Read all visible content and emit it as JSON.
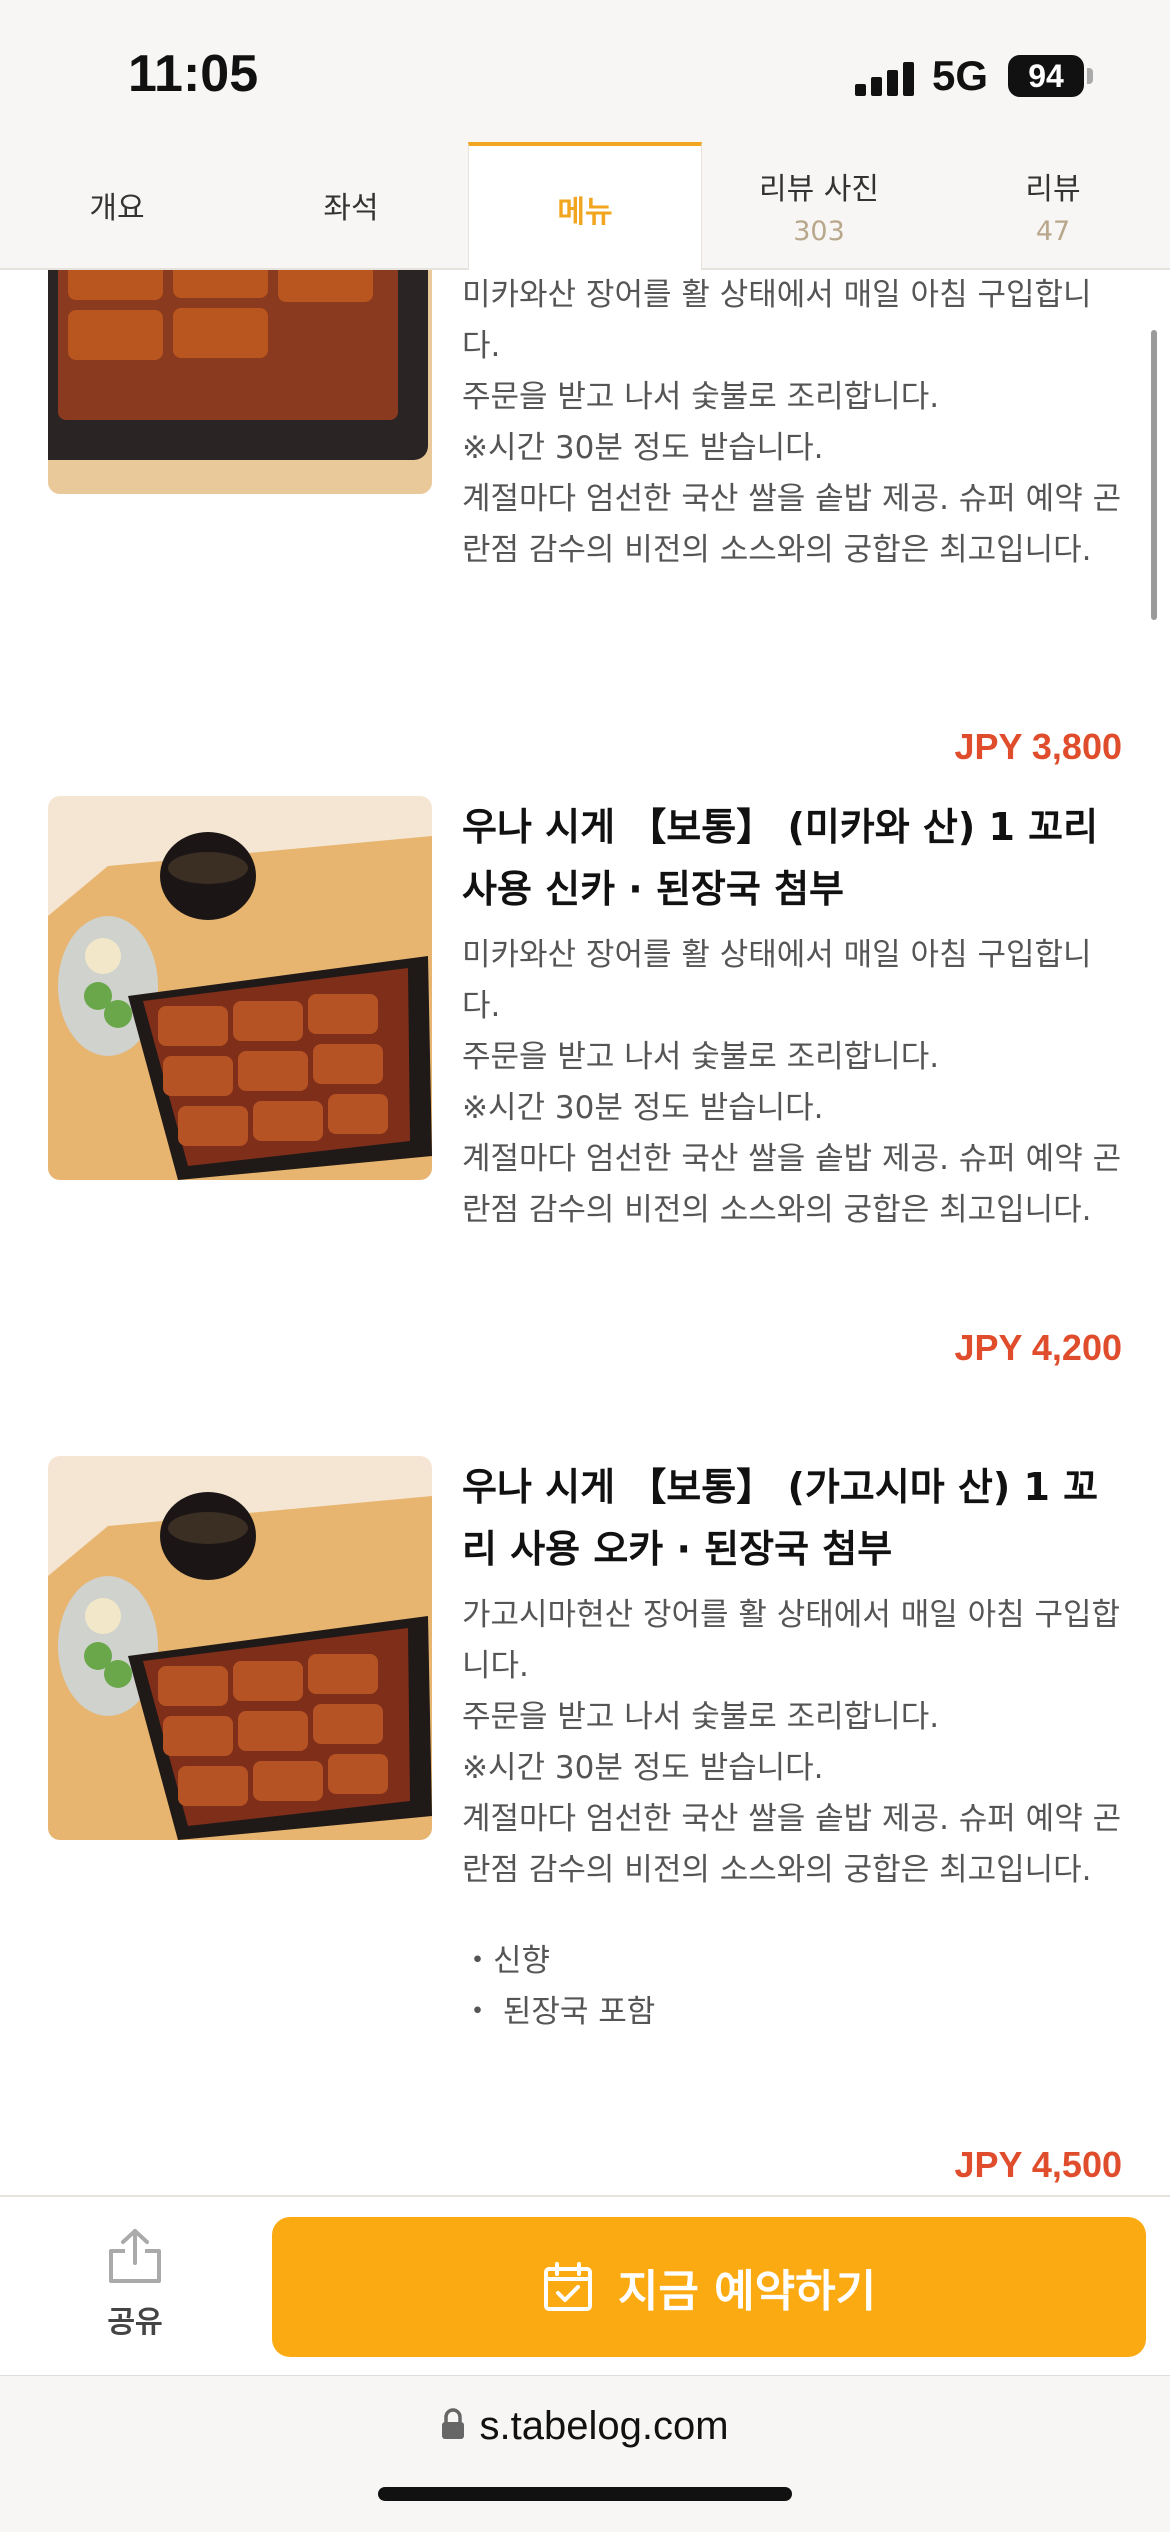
{
  "status_bar": {
    "time": "11:05",
    "network": "5G",
    "battery": "94"
  },
  "tabs": [
    {
      "label": "개요",
      "count": "",
      "active": false
    },
    {
      "label": "좌석",
      "count": "",
      "active": false
    },
    {
      "label": "메뉴",
      "count": "",
      "active": true
    },
    {
      "label": "리뷰 사진",
      "count": "303",
      "active": false
    },
    {
      "label": "리뷰",
      "count": "47",
      "active": false
    }
  ],
  "menu_items": [
    {
      "title": "",
      "description": "미카와산 장어를 활 상태에서 매일 아침 구입합니다.\n주문을 받고 나서 숯불로 조리합니다.\n※시간 30분 정도 받습니다.\n계절마다 엄선한 국산 쌀을 솥밥 제공. 슈퍼 예약 곤란점 감수의 비전의 소스와의 궁합은 최고입니다.",
      "price": "JPY 3,800"
    },
    {
      "title": "우나 시게 【보통】 (미카와 산) 1 꼬리 사용 신카 · 된장국 첨부",
      "description": "미카와산 장어를 활 상태에서 매일 아침 구입합니다.\n주문을 받고 나서 숯불로 조리합니다.\n※시간 30분 정도 받습니다.\n계절마다 엄선한 국산 쌀을 솥밥 제공. 슈퍼 예약 곤란점 감수의 비전의 소스와의 궁합은 최고입니다.",
      "price": "JPY 4,200"
    },
    {
      "title": "우나 시게 【보통】 (가고시마 산) 1 꼬리 사용 오카 · 된장국 첨부",
      "description": "가고시마현산 장어를 활 상태에서 매일 아침 구입합니다.\n주문을 받고 나서 숯불로 조리합니다.\n※시간 30분 정도 받습니다.\n계절마다 엄선한 국산 쌀을 솥밥 제공. 슈퍼 예약 곤란점 감수의 비전의 소스와의 궁합은 최고입니다.",
      "bullets": [
        "・신향",
        "・ 된장국 포함"
      ],
      "price": "JPY 4,500"
    }
  ],
  "actions": {
    "share_label": "공유",
    "reserve_label": "지금 예약하기"
  },
  "browser": {
    "url": "s.tabelog.com"
  },
  "colors": {
    "accent": "#f2a51f",
    "reserve_button": "#fbaa12",
    "price": "#e04d2c"
  },
  "icons": [
    "share-icon",
    "calendar-check-icon",
    "lock-icon"
  ]
}
